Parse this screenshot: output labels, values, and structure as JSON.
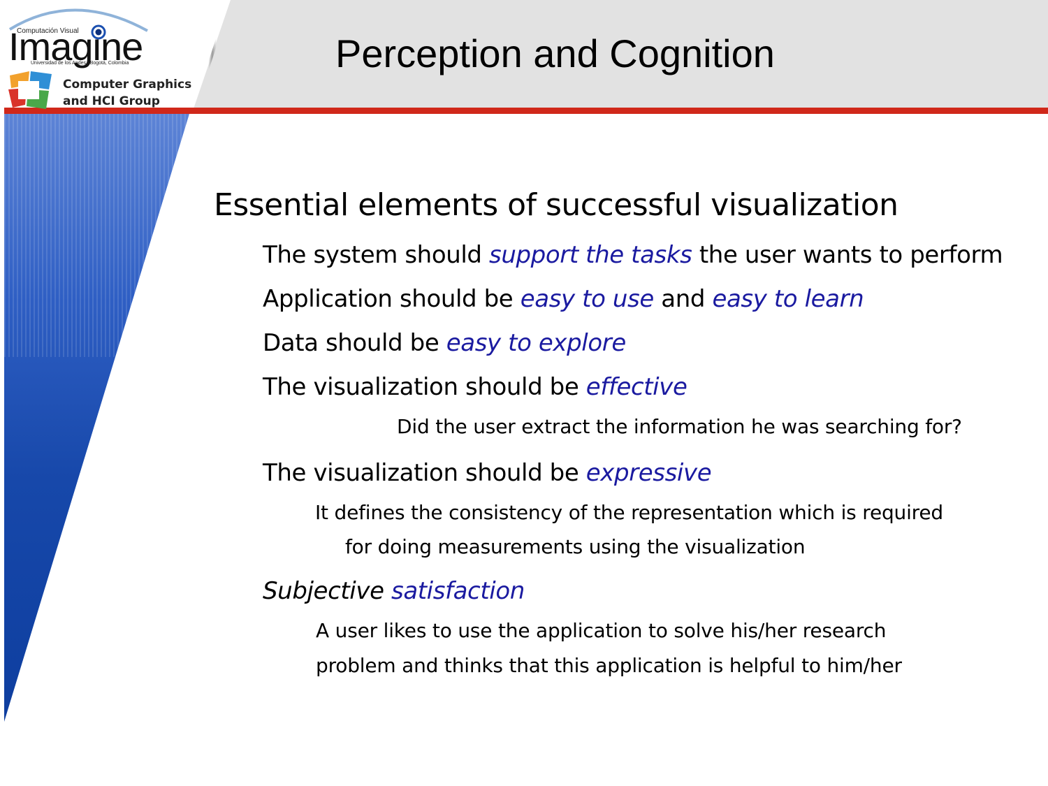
{
  "header": {
    "title": "Perception and Cognition"
  },
  "logo": {
    "small_text": "Computación Visual",
    "wordmark": "Imagine",
    "subline": "Universidad de los Andes | Bogotá, Colombia",
    "group_line1": "Computer Graphics",
    "group_line2": "and HCI Group"
  },
  "content": {
    "heading": "Essential elements of successful visualization",
    "items": [
      {
        "pre": "The system should ",
        "em": "support the tasks",
        "post": " the user wants to perform"
      },
      {
        "pre": "Application should be ",
        "em": "easy to use",
        "mid": " and ",
        "em2": "easy to learn"
      },
      {
        "pre": "Data should be ",
        "em": "easy to explore"
      },
      {
        "pre": "The visualization should be ",
        "em": "effective"
      },
      {
        "sub": "Did the user extract the information he was searching for?"
      },
      {
        "pre": "The visualization should be ",
        "em": "expressive"
      },
      {
        "sub_line1": "It defines the consistency of the representation which is required",
        "sub_line2": "for doing measurements using the visualization"
      },
      {
        "pre_italic": "Subjective ",
        "em": "satisfaction"
      },
      {
        "sub_line1": "A user likes to use the application to solve his/her research",
        "sub_line2": "problem and thinks that this application is helpful to him/her"
      }
    ]
  },
  "colors": {
    "accent_red": "#d0281a",
    "highlight_blue": "#1a1aa0",
    "wedge_blue": "#1748aa",
    "header_gray": "#e2e2e2"
  }
}
